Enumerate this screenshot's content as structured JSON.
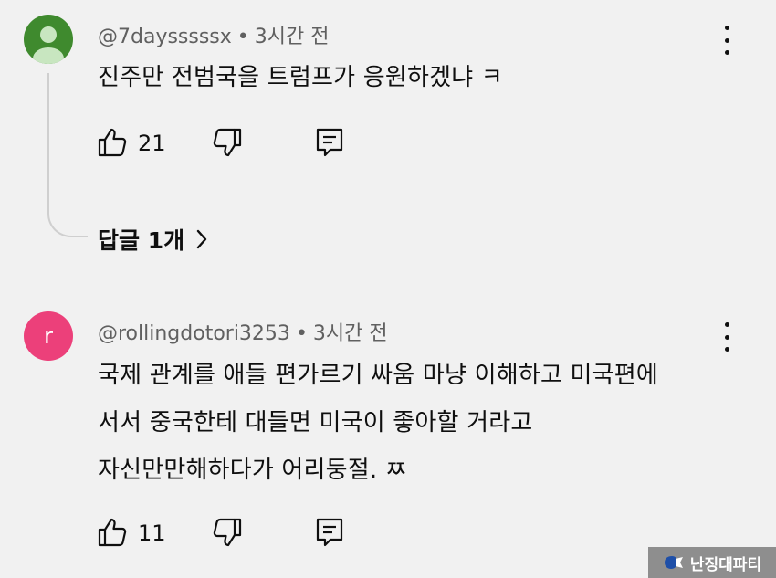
{
  "comments": [
    {
      "handle": "@7daysssssx",
      "separator": "•",
      "time": "3시간 전",
      "lines": [
        "진주만 전범국을 트럼프가 응원하겠냐 ㅋ"
      ],
      "likes": "21",
      "avatar_letter": ""
    },
    {
      "handle": "@rollingdotori3253",
      "separator": "•",
      "time": "3시간 전",
      "lines": [
        "국제 관계를 애들 편가르기 싸움 마냥 이해하고 미국편에",
        "서서 중국한테 대들면 미국이 좋아할 거라고",
        "자신만만해하다가 어리둥절. ㅉ"
      ],
      "likes": "11",
      "avatar_letter": "r"
    }
  ],
  "replies_label": "답글 1개",
  "watermark_text": "난징대파티",
  "colors": {
    "background": "#f1f1f1",
    "avatar_green": "#3f8a2e",
    "avatar_pink": "#ec407a",
    "meta_text": "#606060",
    "watermark_bg": "#8e8e8e"
  },
  "icons": {
    "like": "thumbs-up-icon",
    "dislike": "thumbs-down-icon",
    "reply": "reply-icon",
    "more": "kebab-menu-icon",
    "expand": "chevron-right-icon"
  }
}
